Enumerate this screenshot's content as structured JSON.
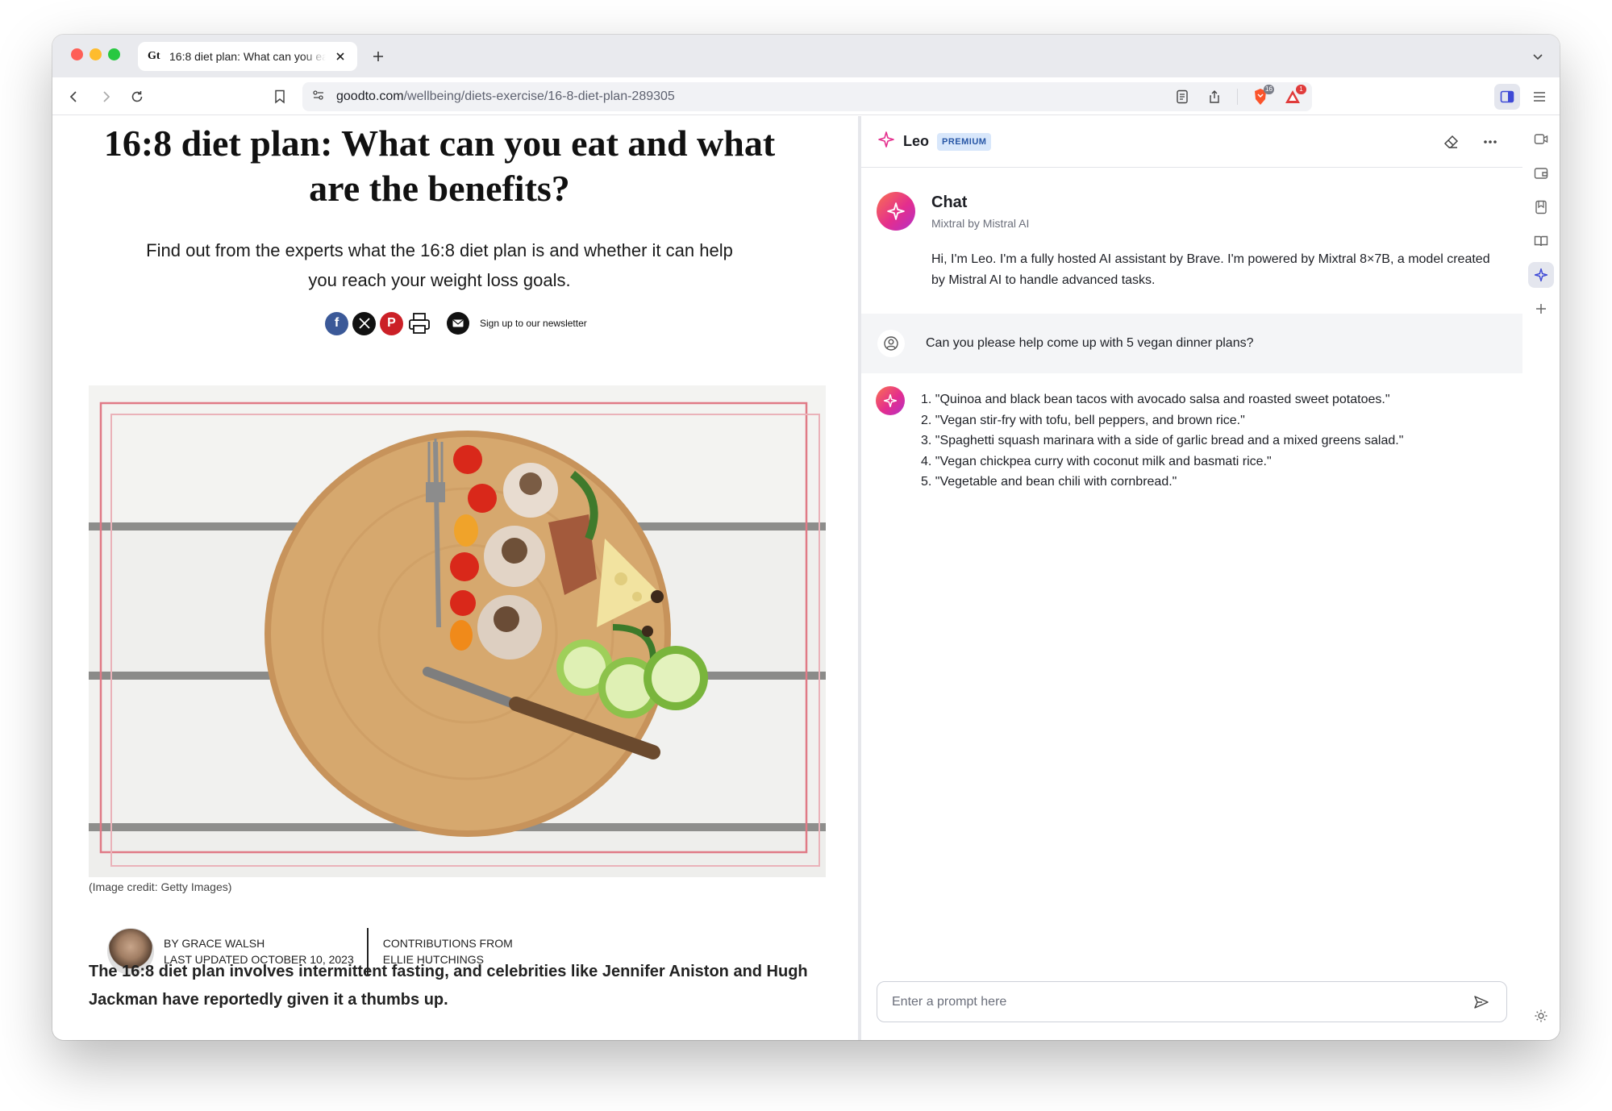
{
  "browser": {
    "tab": {
      "favicon_text": "Gt",
      "title": "16:8 diet plan: What can you eat and what are the benefits?"
    },
    "url": {
      "host": "goodto.com",
      "path": "/wellbeing/diets-exercise/16-8-diet-plan-289305"
    },
    "badges": {
      "shields_count": "16",
      "rewards_count": "1"
    },
    "accent_color": "#3f4ad6"
  },
  "article": {
    "title": "16:8 diet plan: What can you eat and what are the benefits?",
    "subtitle": "Find out from the experts what the 16:8 diet plan is and whether it can help you reach your weight loss goals.",
    "newsletter_label": "Sign up to our newsletter",
    "image_credit": "(Image credit: Getty Images)",
    "byline": {
      "author": "BY GRACE WALSH",
      "updated": "LAST UPDATED OCTOBER 10, 2023",
      "contrib_label": "CONTRIBUTIONS FROM",
      "contributor": "ELLIE HUTCHINGS"
    },
    "lede": "The 16:8 diet plan involves intermittent fasting, and celebrities like Jennifer Aniston and Hugh Jackman have reportedly given it a thumbs up."
  },
  "leo": {
    "name": "Leo",
    "badge": "PREMIUM",
    "intro": {
      "title": "Chat",
      "model": "Mixtral by Mistral AI",
      "text": "Hi, I'm Leo. I'm a fully hosted AI assistant by Brave. I'm powered by Mixtral 8×7B, a model created by Mistral AI to handle advanced tasks."
    },
    "user_message": "Can you please help come up with 5 vegan dinner plans?",
    "answer": [
      "1. \"Quinoa and black bean tacos with avocado salsa and roasted sweet potatoes.\"",
      "2. \"Vegan stir-fry with tofu, bell peppers, and brown rice.\"",
      "3. \"Spaghetti squash marinara with a side of garlic bread and a mixed greens salad.\"",
      "4. \"Vegan chickpea curry with coconut milk and basmati rice.\"",
      "5. \"Vegetable and bean chili with cornbread.\""
    ],
    "prompt_placeholder": "Enter a prompt here",
    "gradient_colors": [
      "#fa7250",
      "#e42e8d",
      "#b42fc7"
    ]
  }
}
